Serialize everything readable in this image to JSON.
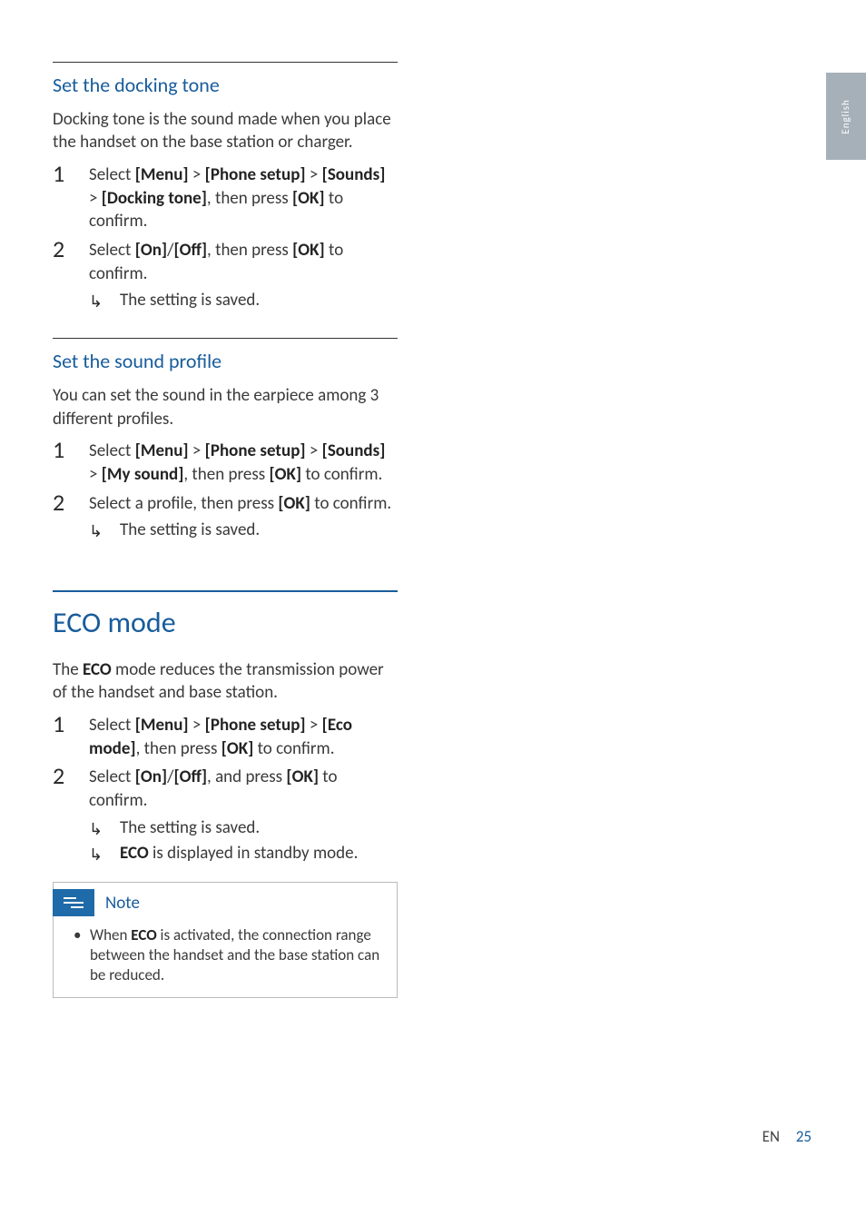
{
  "side_tab": "English",
  "section1": {
    "heading": "Set the docking tone",
    "intro": "Docking tone is the sound made when you place the handset on the base station or charger.",
    "step1": {
      "pre": "Select ",
      "menu": "[Menu]",
      "gt1": " > ",
      "phone": "[Phone setup]",
      "gt2": " > ",
      "sounds": "[Sounds]",
      "gt3": " > ",
      "dock": "[Docking tone]",
      "mid": ", then press ",
      "ok": "[OK]",
      "tail": " to confirm."
    },
    "step2": {
      "pre": "Select ",
      "on": "[On]",
      "slash": "/",
      "off": "[Off]",
      "mid": ", then press ",
      "ok": "[OK]",
      "tail": " to confirm."
    },
    "result": "The setting is saved."
  },
  "section2": {
    "heading": "Set the sound profile",
    "intro": "You can set the sound in the earpiece among 3 different profiles.",
    "step1": {
      "pre": "Select ",
      "menu": "[Menu]",
      "gt1": " > ",
      "phone": "[Phone setup]",
      "gt2": " > ",
      "sounds": "[Sounds]",
      "gt3": " > ",
      "mysound": "[My sound]",
      "mid": ", then press ",
      "ok": "[OK]",
      "tail": " to confirm."
    },
    "step2": {
      "pre": "Select a profile, then press ",
      "ok": "[OK]",
      "tail": " to confirm."
    },
    "result": "The setting is saved."
  },
  "section3": {
    "heading": "ECO mode",
    "intro_pre": "The ",
    "intro_eco": "ECO",
    "intro_post": " mode reduces the transmission power of the handset and base station.",
    "step1": {
      "pre": "Select ",
      "menu": "[Menu]",
      "gt1": " > ",
      "phone": "[Phone setup]",
      "gt2": " > ",
      "eco": "[Eco mode]",
      "mid": ", then press ",
      "ok": "[OK]",
      "tail": " to confirm."
    },
    "step2": {
      "pre": "Select ",
      "on": "[On]",
      "slash": "/",
      "off": "[Off]",
      "mid": ", and press ",
      "ok": "[OK]",
      "tail": " to confirm."
    },
    "result1": "The setting is saved.",
    "result2_eco": "ECO",
    "result2_post": " is displayed in standby mode."
  },
  "note": {
    "label": "Note",
    "body_pre": "When ",
    "body_eco": "ECO",
    "body_post": " is activated, the connection range between the handset and the base station can be reduced."
  },
  "footer": {
    "lang": "EN",
    "page": "25"
  }
}
